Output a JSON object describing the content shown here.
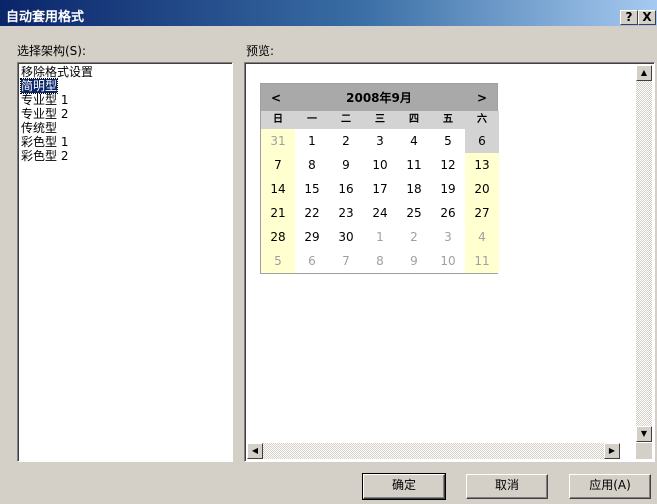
{
  "window": {
    "title": "自动套用格式",
    "help_btn": "?",
    "close_btn": "X"
  },
  "scheme_label": "选择架构(S):",
  "preview_label": "预览:",
  "schemes": [
    "移除格式设置",
    "简明型",
    "专业型 1",
    "专业型 2",
    "传统型",
    "彩色型 1",
    "彩色型 2"
  ],
  "selected_scheme": 1,
  "calendar": {
    "prev": "<",
    "next": ">",
    "title": "2008年9月",
    "weekdays": [
      "日",
      "一",
      "二",
      "三",
      "四",
      "五",
      "六"
    ],
    "weeks": [
      [
        "31",
        "1",
        "2",
        "3",
        "4",
        "5",
        "6"
      ],
      [
        "7",
        "8",
        "9",
        "10",
        "11",
        "12",
        "13"
      ],
      [
        "14",
        "15",
        "16",
        "17",
        "18",
        "19",
        "20"
      ],
      [
        "21",
        "22",
        "23",
        "24",
        "25",
        "26",
        "27"
      ],
      [
        "28",
        "29",
        "30",
        "1",
        "2",
        "3",
        "4"
      ],
      [
        "5",
        "6",
        "7",
        "8",
        "9",
        "10",
        "11"
      ]
    ]
  },
  "buttons": {
    "ok": "确定",
    "cancel": "取消",
    "apply": "应用(A)"
  }
}
